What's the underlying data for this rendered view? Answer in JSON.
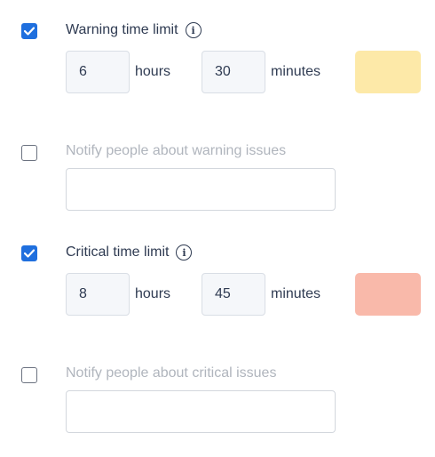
{
  "warning": {
    "checked": true,
    "label": "Warning time limit",
    "hours_value": "6",
    "hours_unit": "hours",
    "minutes_value": "30",
    "minutes_unit": "minutes",
    "color": "#fde9a8"
  },
  "warning_notify": {
    "checked": false,
    "label": "Notify people about warning issues",
    "value": ""
  },
  "critical": {
    "checked": true,
    "label": "Critical time limit",
    "hours_value": "8",
    "hours_unit": "hours",
    "minutes_value": "45",
    "minutes_unit": "minutes",
    "color": "#f9b9aa"
  },
  "critical_notify": {
    "checked": false,
    "label": "Notify people about critical issues",
    "value": ""
  },
  "icons": {
    "info": "info-icon",
    "check": "checkmark-icon"
  },
  "colors": {
    "accent": "#1f6fde",
    "text": "#2f3b52",
    "muted_text": "#b0b5bd"
  }
}
